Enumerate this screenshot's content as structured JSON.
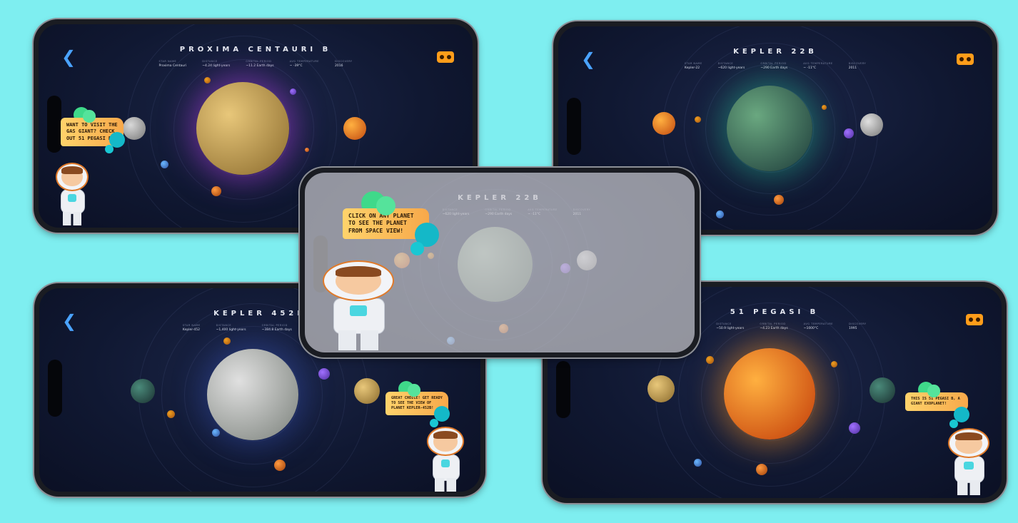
{
  "stat_labels": [
    "Star Name",
    "Distance",
    "Orbital Period",
    "Avg Temperature",
    "Discovery"
  ],
  "phones": [
    {
      "title": "PROXIMA CENTAURI B",
      "stats": [
        "Proxima Centauri",
        "~4.24 light-years",
        "~11.2 Earth days",
        "~ -39°C",
        "2016"
      ],
      "message": "Want to visit the gas giant? Check out 51 Pegasi b!",
      "back_icon": "chevron-left-icon",
      "vr_icon": "vr-headset-icon"
    },
    {
      "title": "KEPLER 22B",
      "stats": [
        "Kepler-22",
        "~620 light-years",
        "~290 Earth days",
        "~ -11°C",
        "2011"
      ],
      "back_icon": "chevron-left-icon",
      "vr_icon": "vr-headset-icon"
    },
    {
      "title": "KEPLER 22B",
      "stats": [
        "Kepler-22",
        "~620 light-years",
        "~290 Earth days",
        "~ -11°C",
        "2011"
      ],
      "message": "Click on any planet to see the planet from space view!"
    },
    {
      "title": "KEPLER 452B",
      "stats": [
        "Kepler-452",
        "~1,400 light-years",
        "~384.8 Earth days",
        "~ -8°C"
      ],
      "message": "Great choice! Get ready to see the view of planet Kepler-452b!",
      "back_icon": "chevron-left-icon"
    },
    {
      "title": "51 PEGASI B",
      "stats": [
        "51 Pegasi",
        "~50.9 light-years",
        "~4.23 Earth days",
        "~1000°C",
        "1995"
      ],
      "message": "This is 51 Pegasi b, a giant exoplanet!",
      "vr_icon": "vr-headset-icon"
    }
  ],
  "colors": {
    "background": "#7eeef0",
    "back_arrow": "#4aa3ff",
    "vr_button": "#ff9d1a",
    "bubble": "#ffd36b"
  }
}
